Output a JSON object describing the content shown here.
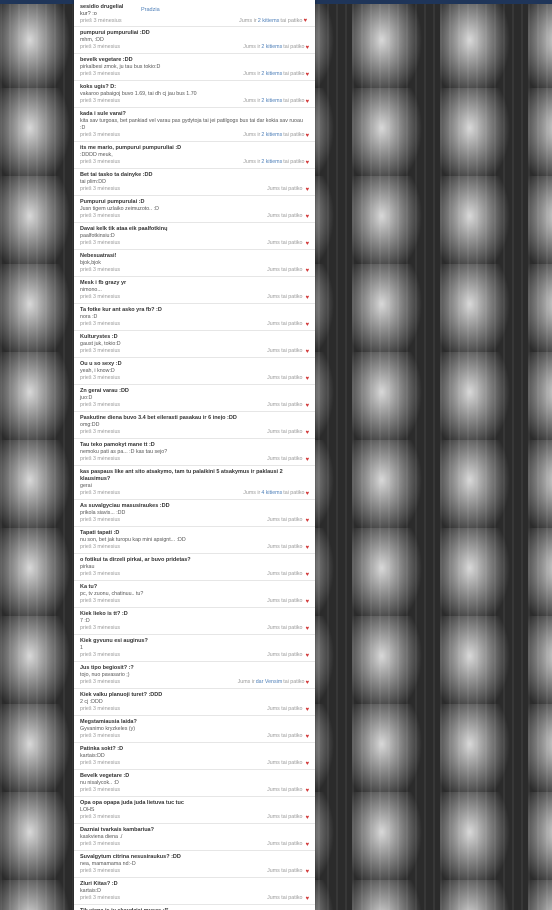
{
  "header": {
    "accent_color": "#1f3559"
  },
  "first_item": {
    "title": "sesidio drugelial",
    "side_link": "Pradzia",
    "text": "kur? :o",
    "time": "prieš 3 mėnesius",
    "like_prefix": "Jums ir ",
    "like_link": "2 kitiems",
    "like_suffix": " tai patiko"
  },
  "items": [
    {
      "title": "pumpurui pumpuruliai :DD",
      "text": "mhm, :DD",
      "time": "prieš 3 mėnesius",
      "like_prefix": "Jums ir ",
      "like_link": "2 kitiems",
      "like_suffix": " tai patiko"
    },
    {
      "title": "bevelk vegetare :DD",
      "text": "pirkalbesi zmok, ju tau bus tokio:D",
      "time": "prieš 3 mėnesius",
      "like_prefix": "Jums ir ",
      "like_link": "2 kitiems",
      "like_suffix": " tai patiko"
    },
    {
      "title": "koks ugis? D:",
      "text": "vakaroo pabaigoj buvo 1.69, tai dh cj jau bus 1.70",
      "time": "prieš 3 mėnesius",
      "like_prefix": "Jums ir ",
      "like_link": "2 kitiems",
      "like_suffix": " tai patiko"
    },
    {
      "title": "kada i sule varai?",
      "text": "kita sav turgoas, bet pankiad vel varau pas gydytoja tai jei patilgogs bus tai dar kokia sav ruoau :D",
      "time": "prieš 3 mėnesius",
      "like_prefix": "Jums ir ",
      "like_link": "2 kitiems",
      "like_suffix": " tai patiko"
    },
    {
      "title": "its me mario, pumpurui pumpuruliai :D",
      "text": ":DDDD meuk,",
      "time": "prieš 3 mėnesius",
      "like_prefix": "Jums ir ",
      "like_link": "2 kitiems",
      "like_suffix": " tai patiko"
    },
    {
      "title": "Bet tai tasko ta dainyke :DD",
      "text": "tai plim:DD",
      "time": "prieš 3 mėnesius",
      "like_prefix": "Jums tai patiko",
      "like_link": "",
      "like_suffix": ""
    },
    {
      "title": "Pumpurui pumpurulai :D",
      "text": "Jusn tigem uzlaiko zeimuzoto.. :D",
      "time": "prieš 3 mėnesius",
      "like_prefix": "Jums tai patiko",
      "like_link": "",
      "like_suffix": ""
    },
    {
      "title": "Davai kelk tik ataa eik paalfotkinų",
      "text": "paalfotkinsiu:D",
      "time": "prieš 3 mėnesius",
      "like_prefix": "Jums tai patiko",
      "like_link": "",
      "like_suffix": ""
    },
    {
      "title": "Nebesuatrasi!",
      "text": "bjok,bjok",
      "time": "prieš 3 mėnesius",
      "like_prefix": "Jums tai patiko",
      "like_link": "",
      "like_suffix": ""
    },
    {
      "title": "Mesk i fb grazy yr",
      "text": "nimono...",
      "time": "prieš 3 mėnesius",
      "like_prefix": "Jums tai patiko",
      "like_link": "",
      "like_suffix": ""
    },
    {
      "title": "Ta fotke kur ant asko yra fb? :D",
      "text": "nora :D",
      "time": "prieš 3 mėnesius",
      "like_prefix": "Jums tai patiko",
      "like_link": "",
      "like_suffix": ""
    },
    {
      "title": "Kulturystes :D",
      "text": "gaust juk, tokio:D",
      "time": "prieš 3 mėnesius",
      "like_prefix": "Jums tai patiko",
      "like_link": "",
      "like_suffix": ""
    },
    {
      "title": "Ou u so sexy :D",
      "text": "yeah, i know:D",
      "time": "prieš 3 mėnesius",
      "like_prefix": "Jums tai patiko",
      "like_link": "",
      "like_suffix": ""
    },
    {
      "title": "Zn gerai varau :DD",
      "text": "juo:D",
      "time": "prieš 3 mėnesius",
      "like_prefix": "Jums tai patiko",
      "like_link": "",
      "like_suffix": ""
    },
    {
      "title": "Paskutine diena buvo 3.4 bet eilerasti pasakau ir 6 ineįo :DD",
      "text": "omg:DD",
      "time": "prieš 3 mėnesius",
      "like_prefix": "Jums tai patiko",
      "like_link": "",
      "like_suffix": ""
    },
    {
      "title": "Tau teko pamokyt mane tt :D",
      "text": "nemoku pati as pa... :D kas tau sejo?",
      "time": "prieš 3 mėnesius",
      "like_prefix": "Jums tai patiko",
      "like_link": "",
      "like_suffix": ""
    },
    {
      "title": "kas paspaus like ant sito atsakymo, tam tu palaikini 5 atsakymus ir paklausi 2 klausimus?",
      "text": "gerai",
      "time": "prieš 3 mėnesius",
      "like_prefix": "Jums ir ",
      "like_link": "4 kitiems",
      "like_suffix": " tai patiko"
    },
    {
      "title": "As suvalgyciau masusiraukes :DD",
      "text": "prikola siavis... :DD",
      "time": "prieš 3 mėnesius",
      "like_prefix": "Jums tai patiko",
      "like_link": "",
      "like_suffix": ""
    },
    {
      "title": "Tapati tapati :D",
      "text": "nu son, bet jak turopu kap mini apsignt... :DD",
      "time": "prieš 3 mėnesius",
      "like_prefix": "Jums tai patiko",
      "like_link": "",
      "like_suffix": ""
    },
    {
      "title": "o fotikui ta dirzeli pirkai, ar buvo pridetas?",
      "text": "pirkau",
      "time": "prieš 3 mėnesius",
      "like_prefix": "Jums tai patiko",
      "like_link": "",
      "like_suffix": ""
    },
    {
      "title": "Ka tu?",
      "text": "pc, tv zuonu, chatinuu.. tu?",
      "time": "prieš 3 mėnesius",
      "like_prefix": "Jums tai patiko",
      "like_link": "",
      "like_suffix": ""
    },
    {
      "title": "Kiek lieko is tt? :D",
      "text": "7 :D",
      "time": "prieš 3 mėnesius",
      "like_prefix": "Jums tai patiko",
      "like_link": "",
      "like_suffix": ""
    },
    {
      "title": "Kiek gyvunu esi auginus?",
      "text": "1",
      "time": "prieš 3 mėnesius",
      "like_prefix": "Jums tai patiko",
      "like_link": "",
      "like_suffix": ""
    },
    {
      "title": "Jus tipo begiosit? :?",
      "text": "tojo, nuo pavasario ;)",
      "time": "prieš 3 mėnesius",
      "like_prefix": "Jums ir ",
      "like_link": "dar Vensim",
      "like_suffix": " tai patiko"
    },
    {
      "title": "Kiek valku planuoji turet? :DDD",
      "text": "2 cj :DDD",
      "time": "prieš 3 mėnesius",
      "like_prefix": "Jums tai patiko",
      "like_link": "",
      "like_suffix": ""
    },
    {
      "title": "Megstamiausia laida?",
      "text": "Gyvanimo kryzkeles (y)",
      "time": "prieš 3 mėnesius",
      "like_prefix": "Jums tai patiko",
      "like_link": "",
      "like_suffix": ""
    },
    {
      "title": "Patinka sokt? :D",
      "text": "kartais:DD",
      "time": "prieš 3 mėnesius",
      "like_prefix": "Jums tai patiko",
      "like_link": "",
      "like_suffix": ""
    },
    {
      "title": "Bevelk vegetare :D",
      "text": "nu nisalycok.. :D",
      "time": "prieš 3 mėnesius",
      "like_prefix": "Jums tai patiko",
      "like_link": "",
      "like_suffix": ""
    },
    {
      "title": "Opa opa opapa juda juda lietuva tuc tuc",
      "text": "LOHS",
      "time": "prieš 3 mėnesius",
      "like_prefix": "Jums tai patiko",
      "like_link": "",
      "like_suffix": ""
    },
    {
      "title": "Dazniai tvarkais kambariua?",
      "text": "kaskviena diena ./",
      "time": "prieš 3 mėnesius",
      "like_prefix": "Jums tai patiko",
      "like_link": "",
      "like_suffix": ""
    },
    {
      "title": "Suvalgytum citrina nesusiraukus? :DD",
      "text": "nea, mamamama nd:-D",
      "time": "prieš 3 mėnesius",
      "like_prefix": "Jums tai patiko",
      "like_link": "",
      "like_suffix": ""
    },
    {
      "title": "Zluri Kitas? :D",
      "text": "kartais:D",
      "time": "prieš 3 mėnesius",
      "like_prefix": "Jums tai patiko",
      "like_link": "",
      "like_suffix": ""
    },
    {
      "title": "Tik viena is ju skaudziai musas :[[",
      "text": "",
      "time": "",
      "like_prefix": "",
      "like_link": "",
      "like_suffix": ""
    }
  ]
}
